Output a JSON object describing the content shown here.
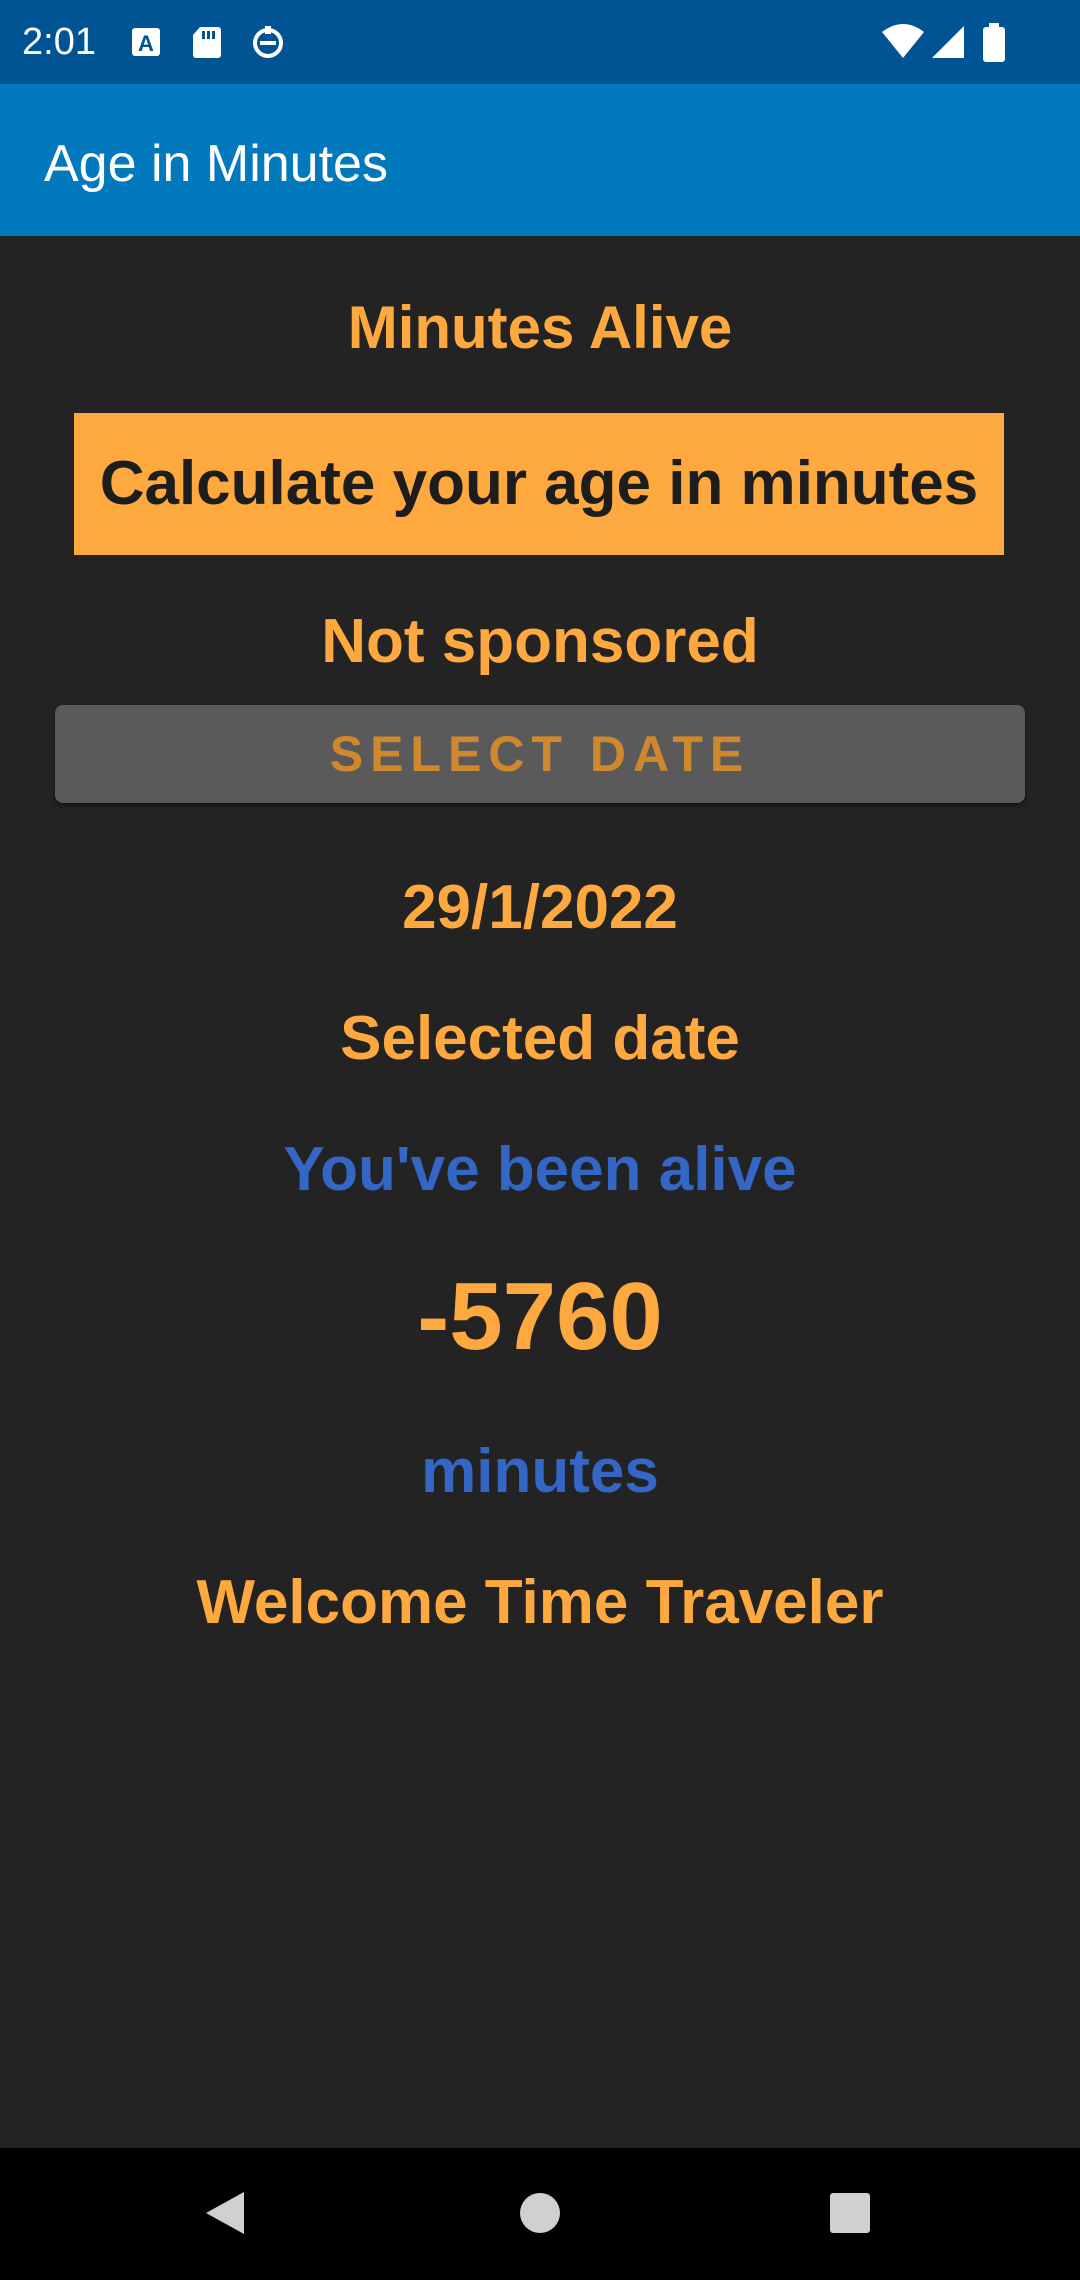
{
  "status_bar": {
    "time": "2:01",
    "left_icons": [
      "text-a-icon",
      "sd-card-icon",
      "vpn-icon"
    ],
    "right_icons": [
      "wifi-icon",
      "signal-icon",
      "battery-icon"
    ]
  },
  "app_bar": {
    "title": "Age in Minutes",
    "color": "#0279bd"
  },
  "main": {
    "heading": "Minutes Alive",
    "banner": "Calculate your age in minutes",
    "sponsor_text": "Not sponsored",
    "select_button_label": "SELECT DATE",
    "date_value": "29/1/2022",
    "date_caption": "Selected date",
    "alive_label": "You've been alive",
    "minutes_value": "-5760",
    "minutes_label": "minutes",
    "message": "Welcome Time Traveler"
  },
  "colors": {
    "accent": "#fea93f",
    "secondary": "#3466c6",
    "background": "#232323"
  },
  "nav_bar": {
    "icons": [
      "back-icon",
      "home-icon",
      "recents-icon"
    ]
  }
}
